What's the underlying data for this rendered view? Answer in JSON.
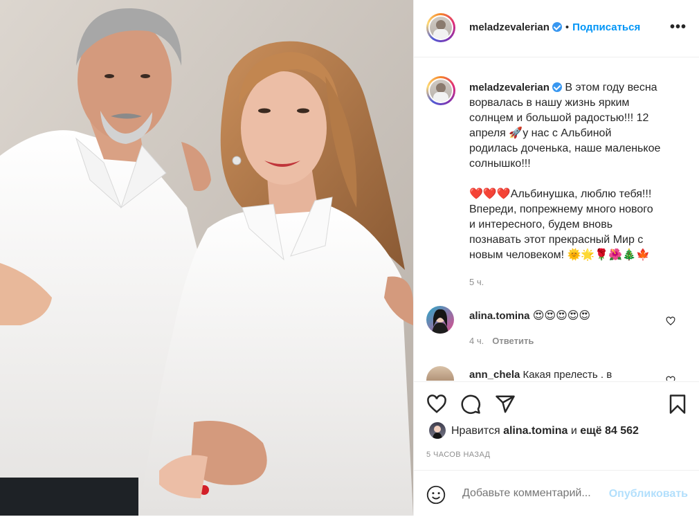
{
  "header": {
    "username": "meladzevalerian",
    "separator": "•",
    "follow_label": "Подписаться",
    "more_label": "•••"
  },
  "caption": {
    "username": "meladzevalerian",
    "line1": "В этом году весна",
    "line2": "ворвалась в нашу жизнь ярким",
    "line3": "солнцем и большой радостью!!! 12",
    "line4_a": "апреля",
    "line4_emoji": "🚀",
    "line4_b": "у нас с Альбиной",
    "line5": "родилась доченька, наше маленькое",
    "line6": "солнышко!!!",
    "hearts": "❤️❤️❤️",
    "line7": "Альбинушка, люблю тебя!!!",
    "line8": "Впереди, попрежнему много нового",
    "line9": "и интересного, будем вновь",
    "line10": "познавать этот прекрасный Мир с",
    "line11": "новым человеком!",
    "line11_emoji": "🌞🌟🌹🌺🎄🍁",
    "time": "5 ч."
  },
  "comments": [
    {
      "username": "alina.tomina",
      "text": "😍😍😍😍😍",
      "time": "4 ч.",
      "reply_label": "Ответить"
    },
    {
      "username": "ann_chela",
      "text": "Какая прелесть . в"
    }
  ],
  "likes": {
    "prefix": "Нравится",
    "user": "alina.tomina",
    "conj": "и",
    "more": "ещё 84 562"
  },
  "timestamp": "5 ЧАСОВ НАЗАД",
  "add_comment": {
    "placeholder": "Добавьте комментарий...",
    "publish_label": "Опубликовать"
  },
  "colors": {
    "accent": "#0095f6",
    "publish_disabled": "#b2dffc",
    "meta": "#8e8e8e",
    "verified": "#3897f0"
  }
}
